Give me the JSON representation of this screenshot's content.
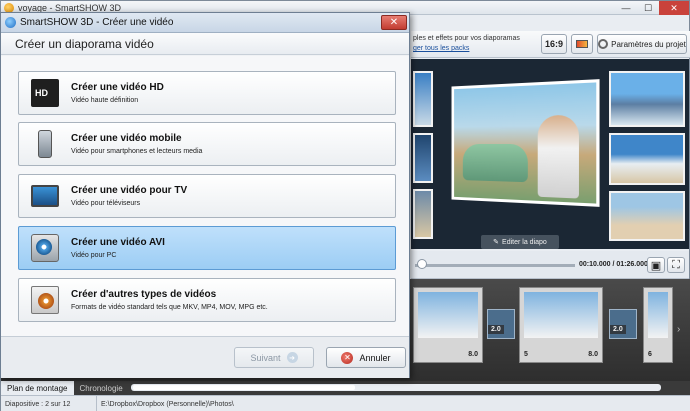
{
  "app": {
    "title": "voyage - SmartSHOW 3D"
  },
  "toolbar": {
    "info_text": "ples et effets pour vos diaporamas",
    "info_link": "ger tous les packs",
    "ratio_label": "16:9",
    "params_label": "Paramètres du projet"
  },
  "preview": {
    "edit_label": "Editer la diapo"
  },
  "player": {
    "time": "00:10.000 / 01:26.000"
  },
  "timeline": {
    "slides": [
      {
        "num": "",
        "duration": "8.0"
      },
      {
        "num": "5",
        "duration": "8.0"
      },
      {
        "num": "6",
        "duration": ""
      }
    ],
    "transitions": [
      "2.0",
      "2.0"
    ]
  },
  "tabs": [
    "Plan de montage",
    "Chronologie"
  ],
  "status": {
    "slide_info": "Diapositive : 2 sur 12",
    "path": "E:\\Dropbox\\Dropbox (Personnelle)\\Photos\\"
  },
  "dialog": {
    "title": "SmartSHOW 3D - Créer une vidéo",
    "header": "Créer un diaporama vidéo",
    "options": [
      {
        "title": "Créer une vidéo HD",
        "subtitle": "Vidéo haute définition",
        "icon": "hd-video-icon"
      },
      {
        "title": "Créer une vidéo mobile",
        "subtitle": "Vidéo pour smartphones et lecteurs media",
        "icon": "mobile-phone-icon"
      },
      {
        "title": "Créer une vidéo pour TV",
        "subtitle": "Vidéo pour téléviseurs",
        "icon": "tv-icon"
      },
      {
        "title": "Créer une vidéo AVI",
        "subtitle": "Vidéo pour PC",
        "icon": "pc-dvd-icon"
      },
      {
        "title": "Créer d'autres types de vidéos",
        "subtitle": "Formats de vidéo standard tels que MKV, MP4, MOV, MPG etc.",
        "icon": "film-reel-icon"
      }
    ],
    "selected_index": 3,
    "next_label": "Suivant",
    "cancel_label": "Annuler"
  }
}
